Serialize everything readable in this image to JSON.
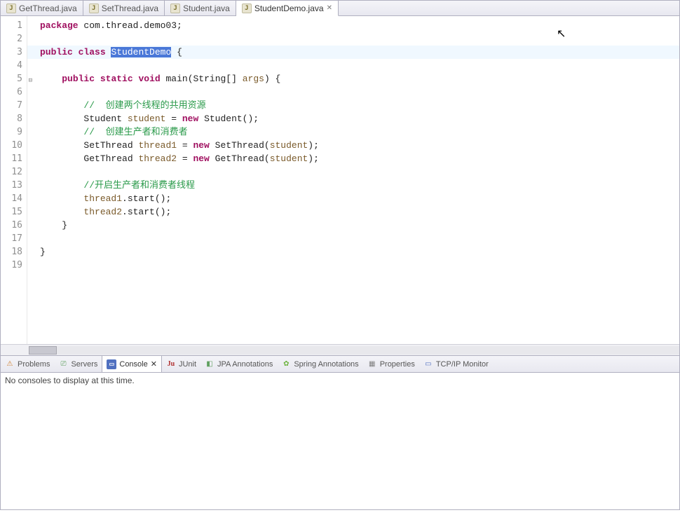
{
  "tabs": [
    {
      "label": "GetThread.java",
      "active": false
    },
    {
      "label": "SetThread.java",
      "active": false
    },
    {
      "label": "Student.java",
      "active": false
    },
    {
      "label": "StudentDemo.java",
      "active": true
    }
  ],
  "gutter_lines": [
    "1",
    "2",
    "3",
    "4",
    "5",
    "6",
    "7",
    "8",
    "9",
    "10",
    "11",
    "12",
    "13",
    "14",
    "15",
    "16",
    "17",
    "18",
    "19"
  ],
  "code": {
    "l1": {
      "kw1": "package",
      "rest": " com.thread.demo03;"
    },
    "l3": {
      "kw1": "public",
      "kw2": "class",
      "sel": "StudentDemo",
      "rest": " {"
    },
    "l5": {
      "indent": "    ",
      "kw1": "public",
      "kw2": "static",
      "kw3": "void",
      "rest1": " main(String[] ",
      "var1": "args",
      "rest2": ") {"
    },
    "l7": {
      "indent": "        ",
      "com": "//  创建两个线程的共用资源"
    },
    "l8": {
      "indent": "        ",
      "txt1": "Student ",
      "var1": "student",
      "txt2": " = ",
      "kw1": "new",
      "txt3": " Student();"
    },
    "l9": {
      "indent": "        ",
      "com": "//  创建生产者和消费者"
    },
    "l10": {
      "indent": "        ",
      "txt1": "SetThread ",
      "var1": "thread1",
      "txt2": " = ",
      "kw1": "new",
      "txt3": " SetThread(",
      "var2": "student",
      "txt4": ");"
    },
    "l11": {
      "indent": "        ",
      "txt1": "GetThread ",
      "var1": "thread2",
      "txt2": " = ",
      "kw1": "new",
      "txt3": " GetThread(",
      "var2": "student",
      "txt4": ");"
    },
    "l13": {
      "indent": "        ",
      "com": "//开启生产者和消费者线程"
    },
    "l14": {
      "indent": "        ",
      "var1": "thread1",
      "txt1": ".start();"
    },
    "l15": {
      "indent": "        ",
      "var1": "thread2",
      "txt1": ".start();"
    },
    "l16": {
      "indent": "    ",
      "txt": "}"
    },
    "l18": {
      "txt": "}"
    }
  },
  "bottom_tabs": {
    "problems": "Problems",
    "servers": "Servers",
    "console": "Console",
    "junit": "JUnit",
    "jpa": "JPA Annotations",
    "spring": "Spring Annotations",
    "properties": "Properties",
    "tcp": "TCP/IP Monitor"
  },
  "console_msg": "No consoles to display at this time.",
  "close_glyph": "✕"
}
